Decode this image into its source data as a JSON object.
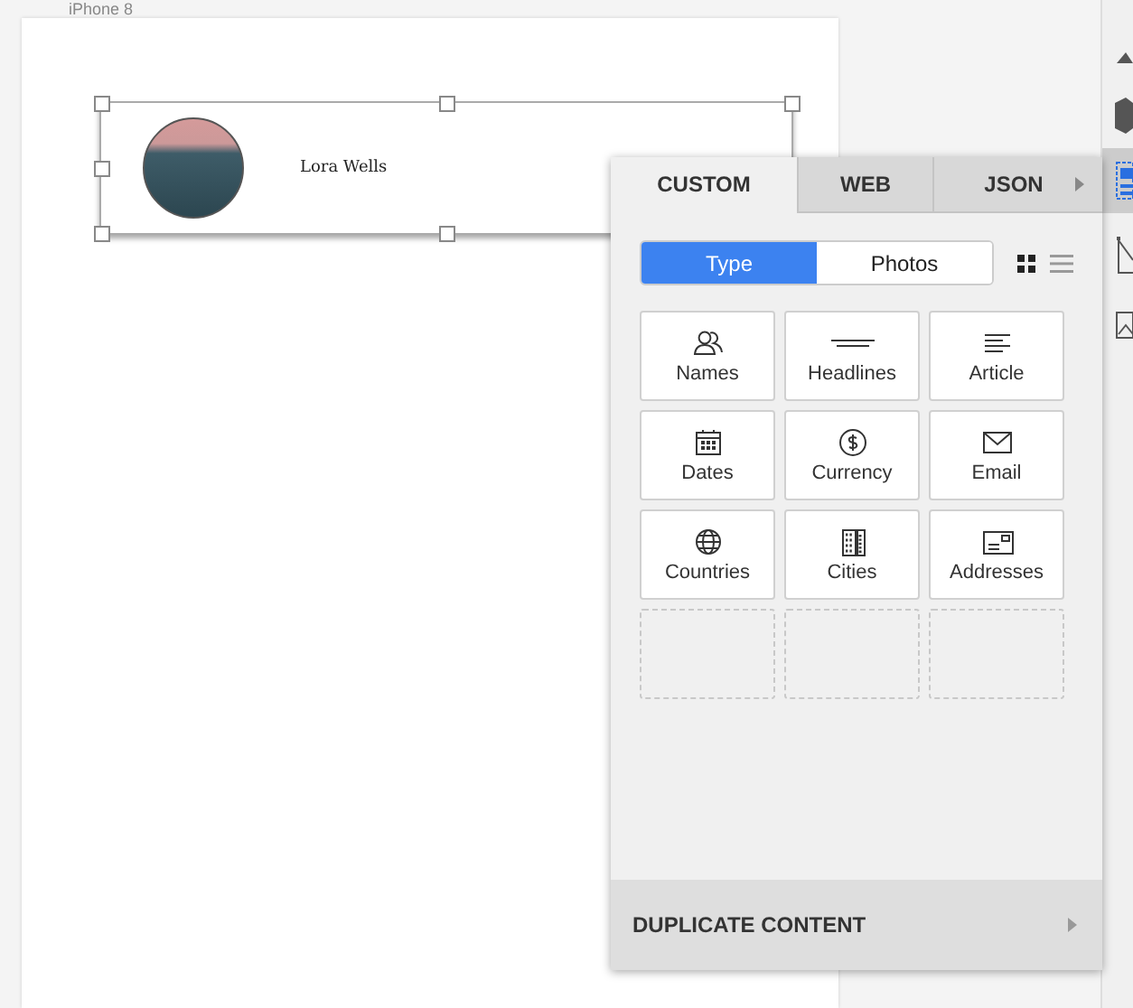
{
  "artboard": {
    "label": "iPhone 8"
  },
  "symbol": {
    "name": "Lora Wells"
  },
  "panel": {
    "tabs": [
      {
        "label": "CUSTOM",
        "selected": true
      },
      {
        "label": "WEB",
        "selected": false
      },
      {
        "label": "JSON",
        "selected": false
      }
    ],
    "segments": [
      {
        "label": "Type",
        "selected": true
      },
      {
        "label": "Photos",
        "selected": false
      }
    ],
    "view_modes": [
      {
        "kind": "grid",
        "selected": true
      },
      {
        "kind": "list",
        "selected": false
      }
    ],
    "types": [
      {
        "kind": "names",
        "label": "Names"
      },
      {
        "kind": "headlines",
        "label": "Headlines"
      },
      {
        "kind": "article",
        "label": "Article"
      },
      {
        "kind": "dates",
        "label": "Dates"
      },
      {
        "kind": "currency",
        "label": "Currency"
      },
      {
        "kind": "email",
        "label": "Email"
      },
      {
        "kind": "countries",
        "label": "Countries"
      },
      {
        "kind": "cities",
        "label": "Cities"
      },
      {
        "kind": "addresses",
        "label": "Addresses"
      },
      {
        "kind": "empty"
      },
      {
        "kind": "empty"
      },
      {
        "kind": "empty"
      }
    ],
    "footer": {
      "label": "DUPLICATE CONTENT"
    }
  }
}
